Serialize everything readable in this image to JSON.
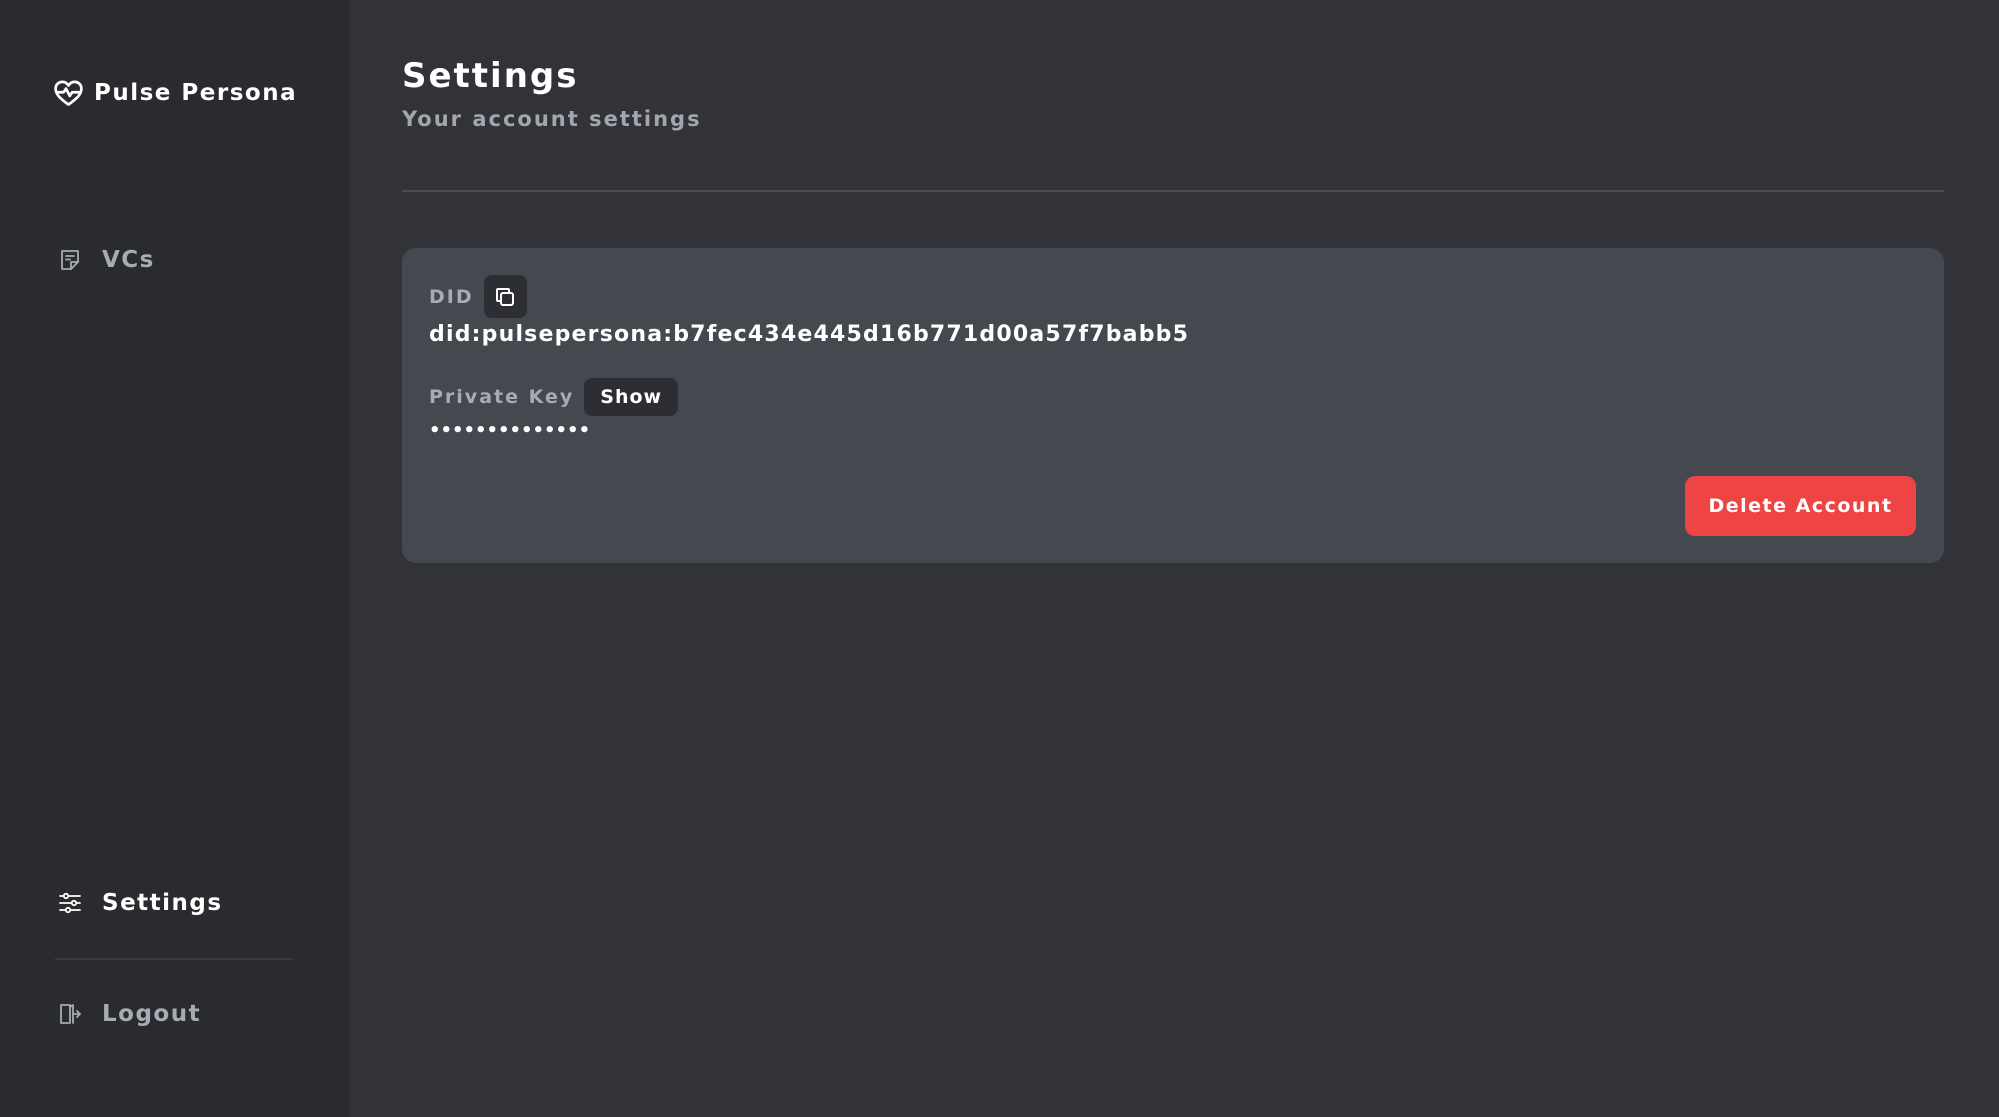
{
  "brand": {
    "name": "Pulse Persona",
    "icon": "heart-pulse-icon"
  },
  "sidebar": {
    "items": [
      {
        "label": "VCs",
        "icon": "document-icon",
        "active": false
      },
      {
        "label": "Settings",
        "icon": "sliders-icon",
        "active": true
      },
      {
        "label": "Logout",
        "icon": "logout-icon",
        "active": false
      }
    ]
  },
  "header": {
    "title": "Settings",
    "subtitle": "Your account settings"
  },
  "settings_card": {
    "did_label": "DID",
    "did_value": "did:pulsepersona:b7fec434e445d16b771d00a57f7babb5",
    "copy_icon": "copy-icon",
    "private_key_label": "Private Key",
    "show_label": "Show",
    "private_key_masked": "••••••••••••••",
    "delete_label": "Delete Account"
  },
  "colors": {
    "background": "#323338",
    "sidebar": "#2a2b2f",
    "card": "#45484f",
    "danger": "#ef4444"
  }
}
